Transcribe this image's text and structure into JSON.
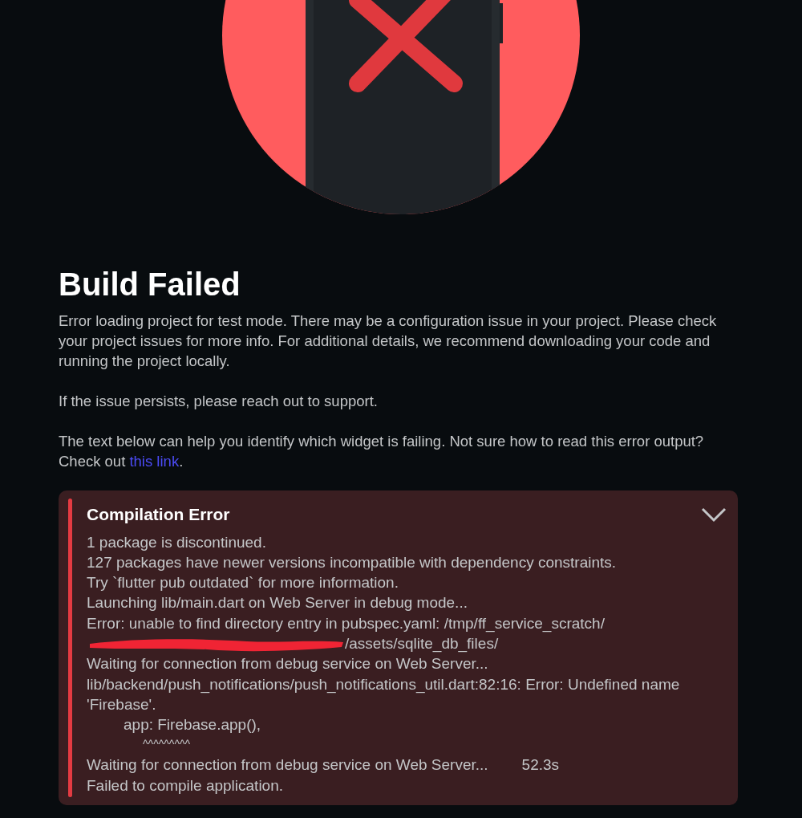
{
  "title": "Build Failed",
  "paragraphs": [
    {
      "text": "Error loading project for test mode. There may be a configuration issue in your project. Please check your project issues for more info. For additional details, we recommend downloading your code and running the project locally."
    },
    {
      "text": "If the issue persists, please reach out to support."
    },
    {
      "text": "The text below can help you identify which widget is failing. Not sure how to read this error output? Check out ",
      "link": "this link",
      "after": "."
    }
  ],
  "error_panel": {
    "title": "Compilation Error",
    "expanded": true,
    "lines": [
      {
        "kind": "text",
        "text": "1 package is discontinued."
      },
      {
        "kind": "text",
        "text": "127 packages have newer versions incompatible with dependency constraints."
      },
      {
        "kind": "text",
        "text": "Try `flutter pub outdated` for more information."
      },
      {
        "kind": "text",
        "text": "Launching lib/main.dart on Web Server in debug mode..."
      },
      {
        "kind": "text",
        "text": "Error: unable to find directory entry in pubspec.yaml: /tmp/ff_service_scratch/"
      },
      {
        "kind": "redacted",
        "text": "/assets/sqlite_db_files/"
      },
      {
        "kind": "text",
        "text": "Waiting for connection from debug service on Web Server..."
      },
      {
        "kind": "text",
        "text": "lib/backend/push_notifications/push_notifications_util.dart:82:16: Error: Undefined name 'Firebase'."
      },
      {
        "kind": "code",
        "text": "app: Firebase.app(),"
      },
      {
        "kind": "marker",
        "text": "^^^^^^^^^"
      },
      {
        "kind": "timed",
        "text": "Waiting for connection from debug service on Web Server...",
        "time": "52.3s"
      },
      {
        "kind": "text",
        "text": "Failed to compile application."
      }
    ]
  }
}
